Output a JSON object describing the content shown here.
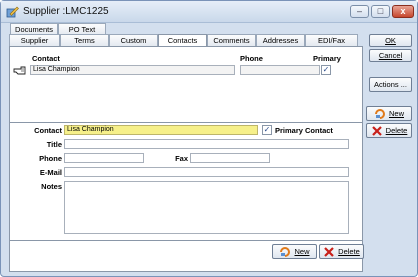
{
  "window": {
    "title": "Supplier :LMC1225",
    "minimize": "–",
    "restore": "□",
    "close": "x"
  },
  "tabs_top": [
    {
      "label": "Documents"
    },
    {
      "label": "PO Text"
    }
  ],
  "tabs_main": [
    {
      "label": "Supplier"
    },
    {
      "label": "Terms"
    },
    {
      "label": "Custom"
    },
    {
      "label": "Contacts",
      "active": true
    },
    {
      "label": "Comments"
    },
    {
      "label": "Addresses"
    },
    {
      "label": "EDI/Fax"
    }
  ],
  "grid": {
    "headers": {
      "contact": "Contact",
      "phone": "Phone",
      "primary": "Primary"
    },
    "rows": [
      {
        "contact": "Lisa Champion",
        "phone": "",
        "primary": true
      }
    ]
  },
  "form": {
    "contact_label": "Contact",
    "contact_value": "Lisa Champion",
    "primary_label": "Primary Contact",
    "primary_checked": true,
    "title_label": "Title",
    "title_value": "",
    "phone_label": "Phone",
    "phone_value": "",
    "fax_label": "Fax",
    "fax_value": "",
    "email_label": "E-Mail",
    "email_value": "",
    "notes_label": "Notes",
    "notes_value": ""
  },
  "panel_buttons": {
    "new_label": "New",
    "delete_label": "Delete"
  },
  "side_buttons": {
    "ok_label": "OK",
    "cancel_label": "Cancel",
    "actions_label": "Actions ...",
    "new_label": "New",
    "delete_label": "Delete"
  },
  "colors": {
    "window_bg": "#d3dfee",
    "highlight_field": "#f6f08a",
    "delete_icon": "#c8201a",
    "new_icon": "#e07a1a"
  }
}
